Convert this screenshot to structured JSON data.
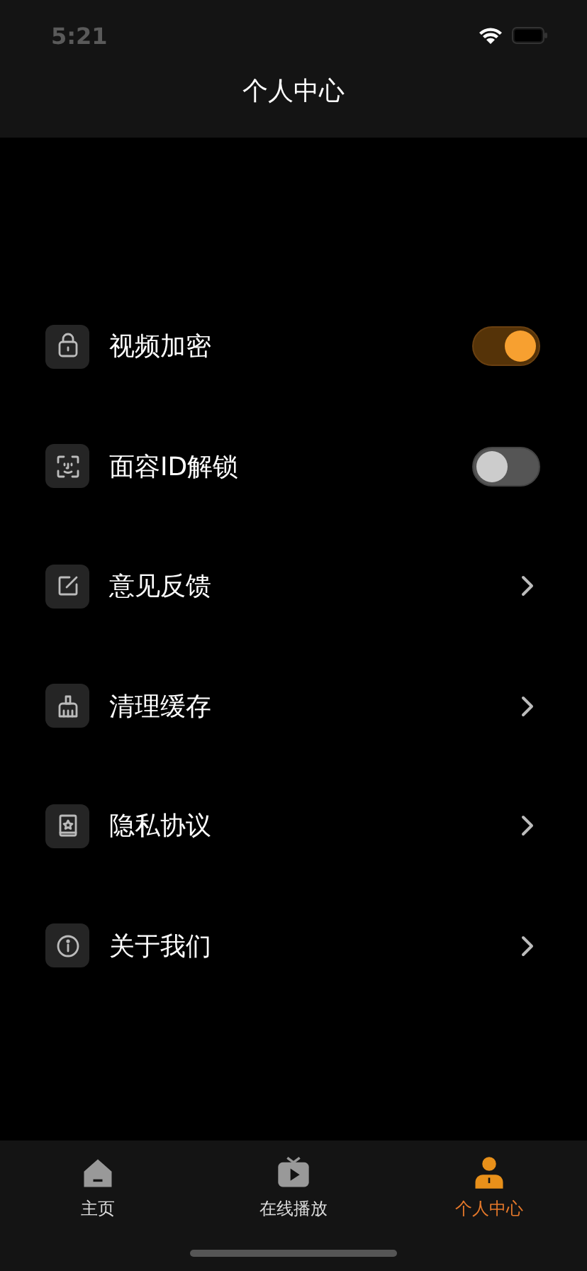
{
  "status_bar": {
    "time": "5:21"
  },
  "nav_bar": {
    "title": "个人中心"
  },
  "settings": [
    {
      "label": "视频加密",
      "kind": "toggle",
      "on": true
    },
    {
      "label": "面容ID解锁",
      "kind": "toggle",
      "on": false
    },
    {
      "label": "意见反馈",
      "kind": "link"
    },
    {
      "label": "清理缓存",
      "kind": "link"
    },
    {
      "label": "隐私协议",
      "kind": "link"
    },
    {
      "label": "关于我们",
      "kind": "link"
    }
  ],
  "tab_bar": [
    {
      "label": "主页",
      "selected": false
    },
    {
      "label": "在线播放",
      "selected": false
    },
    {
      "label": "个人中心",
      "selected": true
    }
  ]
}
